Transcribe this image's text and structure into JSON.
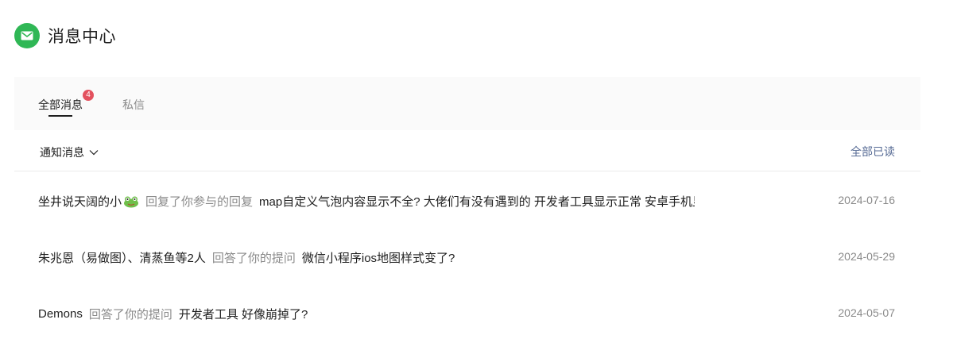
{
  "header": {
    "title": "消息中心",
    "icon": "mail-icon",
    "icon_color": "#2fb755"
  },
  "tabs": {
    "all_label": "全部消息",
    "all_badge": "4",
    "pm_label": "私信"
  },
  "filter": {
    "label": "通知消息",
    "icon": "chevron-down-icon"
  },
  "mark_all_read": "全部已读",
  "messages": [
    {
      "user": "坐井说天阔的小",
      "user_icon": "frog-icon",
      "action": "回复了你参与的回复",
      "content": "map自定义气泡内容显示不全? 大佬们有没有遇到的 开发者工具显示正常 安卓手机显",
      "date": "2024-07-16"
    },
    {
      "user": "朱兆恩（易做图）、清蒸鱼等2人",
      "action": "回答了你的提问",
      "content": "微信小程序ios地图样式变了?",
      "date": "2024-05-29"
    },
    {
      "user": "Demons",
      "action": "回答了你的提问",
      "content": "开发者工具 好像崩掉了?",
      "date": "2024-05-07"
    }
  ],
  "colors": {
    "accent": "#576b95",
    "badge": "#e3515e",
    "muted": "#8a8a8a"
  }
}
